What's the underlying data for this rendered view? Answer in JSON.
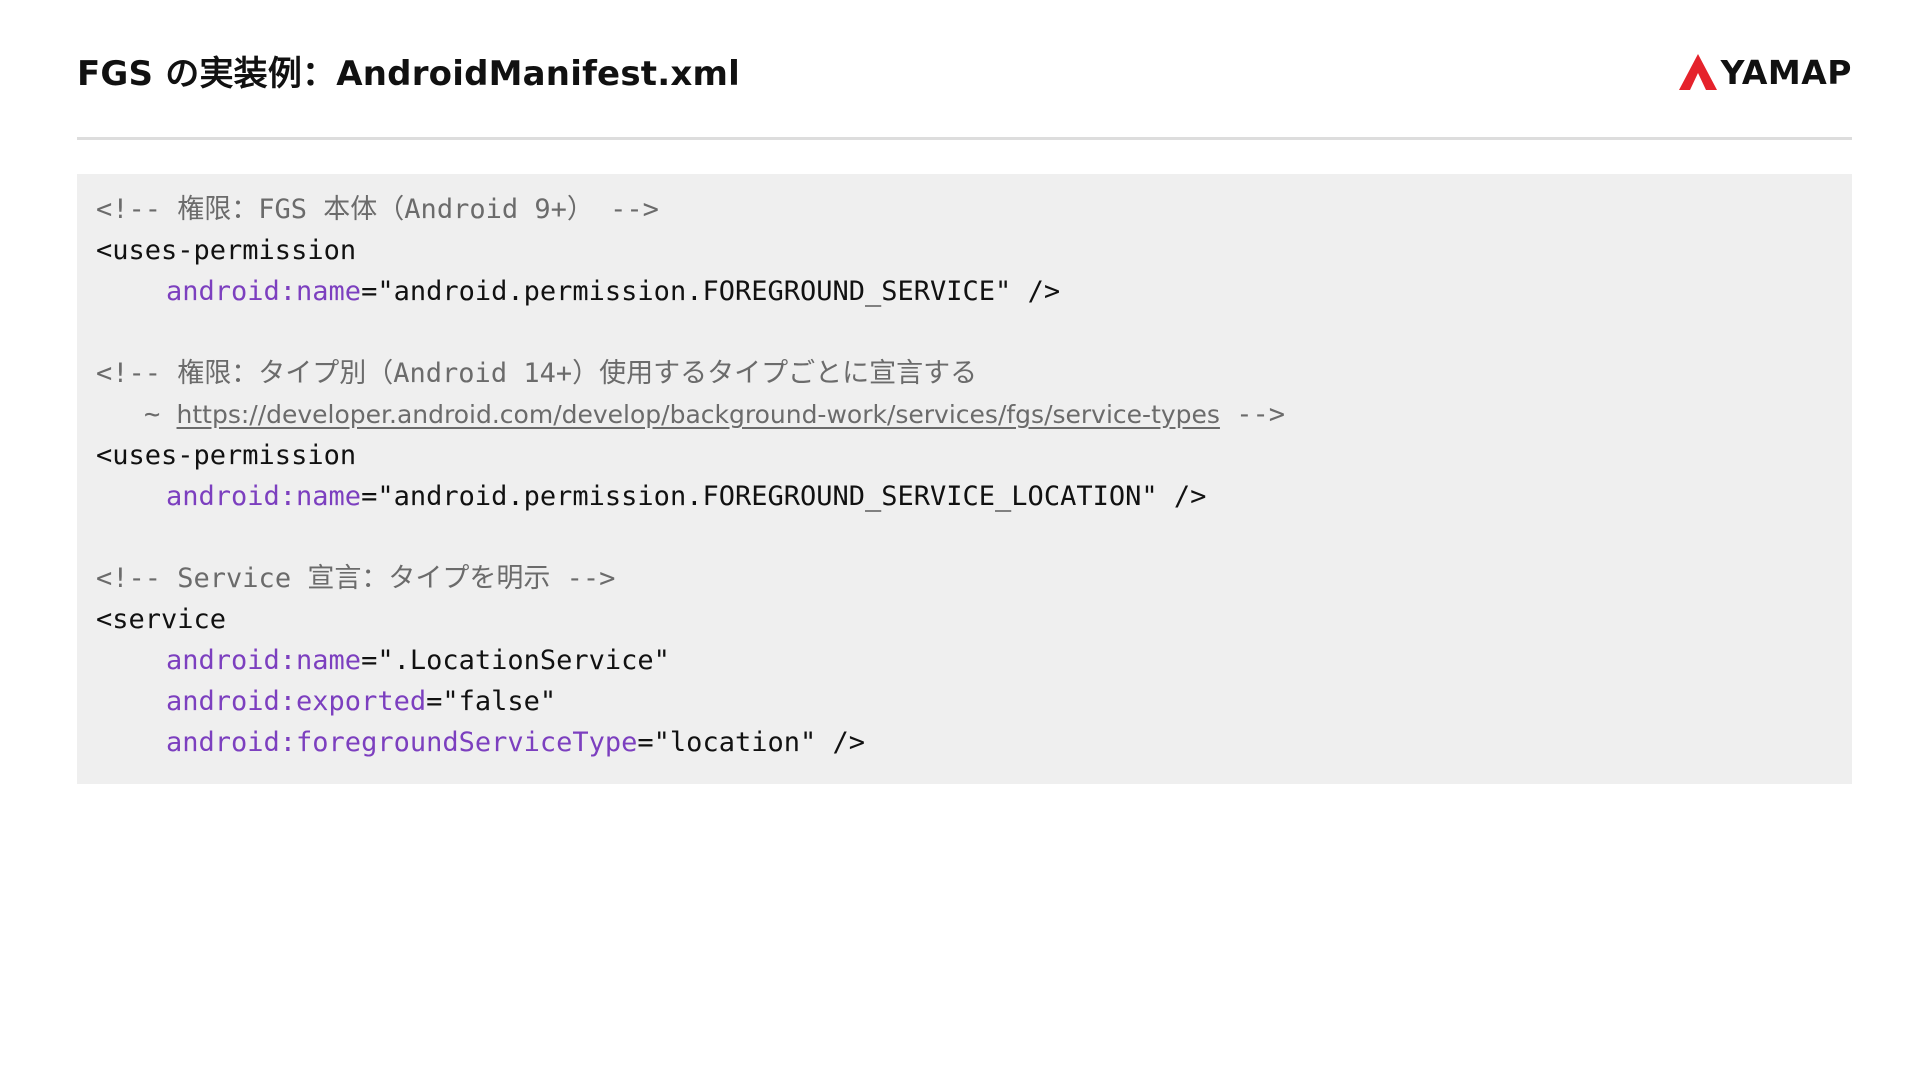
{
  "header": {
    "title": "FGS の実装例：AndroidManifest.xml",
    "logo_text": "YAMAP",
    "logo_color": "#e5222b"
  },
  "code": {
    "block1": {
      "comment_open": "<!-- ",
      "comment_text": "権限：FGS 本体（Android 9+）",
      "comment_close": " -->",
      "tag": "<uses-permission",
      "attr": "android:name",
      "eq": "=",
      "value": "\"android.permission.FOREGROUND_SERVICE\"",
      "close": " />"
    },
    "block2": {
      "comment_open": "<!-- ",
      "comment_text": "権限：タイプ別（Android 14+）使用するタイプごとに宣言する",
      "tilde": "~ ",
      "link_text": "https://developer.android.com/develop/background-work/services/fgs/service-types",
      "comment_close": " -->",
      "tag": "<uses-permission",
      "attr": "android:name",
      "eq": "=",
      "value": "\"android.permission.FOREGROUND_SERVICE_LOCATION\"",
      "close": " />"
    },
    "block3": {
      "comment_open": "<!-- ",
      "comment_text": "Service 宣言：タイプを明示",
      "comment_close": " -->",
      "tag": "<service",
      "attr1": "android:name",
      "value1": "\".LocationService\"",
      "attr2": "android:exported",
      "value2": "\"false\"",
      "attr3": "android:foregroundServiceType",
      "value3": "\"location\"",
      "eq": "=",
      "close": " />"
    }
  }
}
